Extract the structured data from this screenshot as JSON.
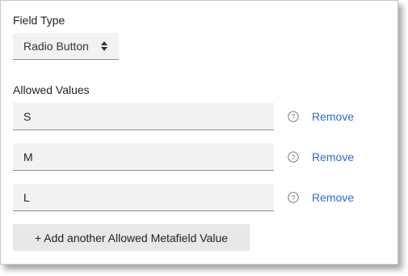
{
  "field_type": {
    "label": "Field Type",
    "select_value": "Radio Button",
    "caret_icon": "up-down-caret-icon"
  },
  "allowed_values": {
    "label": "Allowed Values",
    "rows": [
      {
        "value": "S",
        "help_icon": "question-circle-icon",
        "remove_label": "Remove"
      },
      {
        "value": "M",
        "help_icon": "question-circle-icon",
        "remove_label": "Remove"
      },
      {
        "value": "L",
        "help_icon": "question-circle-icon",
        "remove_label": "Remove"
      }
    ],
    "add_button_label": "+ Add another Allowed Metafield Value"
  },
  "colors": {
    "link": "#2f6bd6",
    "input_bg": "#f2f2f2",
    "button_bg": "#e8e8e8"
  }
}
